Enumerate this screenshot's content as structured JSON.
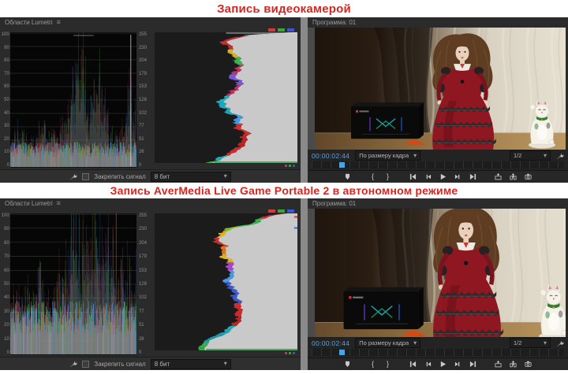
{
  "page": {
    "top_title": "Запись видеокамерой",
    "middle_title": "Запись AverMedia Live Game Portable 2 в автономном режиме"
  },
  "scopes": {
    "panel_title": "Области Lumetri",
    "ire_scale": [
      "100",
      "90",
      "80",
      "70",
      "60",
      "50",
      "40",
      "30",
      "20",
      "10",
      "0"
    ],
    "level_scale": [
      "255",
      "230",
      "204",
      "179",
      "153",
      "128",
      "102",
      "77",
      "51",
      "26",
      "0"
    ],
    "clamp_label": "Закрепить сигнал",
    "bit_depth_value": "8 бит"
  },
  "monitor": {
    "panel_title": "Программа: 01",
    "timecode": "00:00:02:44",
    "fit_label": "По размеру кадра",
    "playback_resolution": "1/2"
  },
  "icons": {
    "panel_menu": "≡",
    "caret": "▾",
    "mark_in": "{",
    "mark_out": "}"
  },
  "colors": {
    "title_red": "#d72620",
    "timecode_blue": "#5aa2dc",
    "playhead_blue": "#4da3e0",
    "histogram_gray": "#c9c9c9",
    "swatch_red": "#d23b3b",
    "swatch_green": "#3ba33b",
    "swatch_blue": "#3b56d2"
  }
}
